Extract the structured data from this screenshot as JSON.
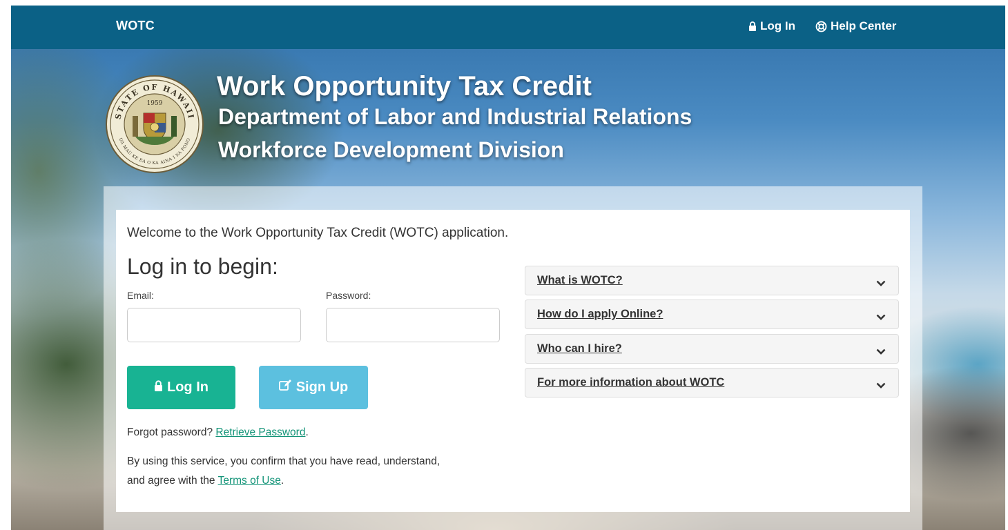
{
  "nav": {
    "brand": "WOTC",
    "login_label": "Log In",
    "help_label": "Help Center"
  },
  "header": {
    "title": "Work Opportunity Tax Credit",
    "subtitle1": "Department of Labor and Industrial Relations",
    "subtitle2": "Workforce Development Division",
    "seal_top_text": "STATE OF HAWAII",
    "seal_year": "1959",
    "seal_bottom_text": "UA MAU KE EA O KA AINA I KA PONO"
  },
  "main": {
    "welcome": "Welcome to the Work Opportunity Tax Credit (WOTC) application.",
    "heading": "Log in to begin:",
    "email_label": "Email:",
    "password_label": "Password:",
    "email_value": "",
    "password_value": "",
    "login_button": "Log In",
    "signup_button": "Sign Up",
    "forgot_prefix": "Forgot password?",
    "forgot_link": "Retrieve Password",
    "forgot_suffix": ".",
    "terms_line1": "By using this service, you confirm that you have read, understand,",
    "terms_prefix": "and agree with the",
    "terms_link": "Terms of Use",
    "terms_suffix": "."
  },
  "accordion": {
    "items": [
      {
        "label": "What is WOTC?"
      },
      {
        "label": "How do I apply Online?"
      },
      {
        "label": "Who can I hire?"
      },
      {
        "label": "For more information about WOTC"
      }
    ]
  },
  "colors": {
    "nav_bg": "#0b6186",
    "login_button": "#18b393",
    "signup_button": "#5cc0df",
    "link": "#139478"
  },
  "icons": {
    "login": "lock-icon",
    "help": "lifebuoy-icon",
    "signup": "edit-icon",
    "accordion": "chevron-down-icon"
  }
}
